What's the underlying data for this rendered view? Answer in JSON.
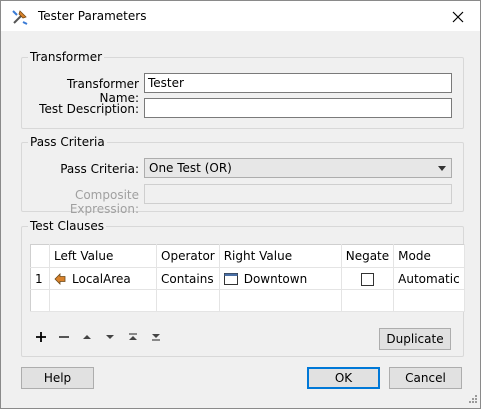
{
  "window": {
    "title": "Tester Parameters"
  },
  "transformer_group": {
    "label": "Transformer",
    "name_label": "Transformer Name:",
    "name_value": "Tester",
    "description_label": "Test Description:",
    "description_value": ""
  },
  "pass_criteria_group": {
    "label": "Pass Criteria",
    "criteria_label": "Pass Criteria:",
    "criteria_value": "One Test (OR)",
    "composite_label": "Composite Expression:",
    "composite_value": ""
  },
  "test_clauses_group": {
    "label": "Test Clauses",
    "columns": [
      "Left Value",
      "Operator",
      "Right Value",
      "Negate",
      "Mode"
    ],
    "rows": [
      {
        "num": "1",
        "left": "LocalArea",
        "operator": "Contains",
        "right": "Downtown",
        "negate": false,
        "mode": "Automatic"
      }
    ]
  },
  "toolbar": {
    "icons": [
      "add-icon",
      "remove-icon",
      "move-up-icon",
      "move-down-icon",
      "move-top-icon",
      "move-bottom-icon"
    ],
    "duplicate_label": "Duplicate"
  },
  "footer": {
    "help_label": "Help",
    "ok_label": "OK",
    "cancel_label": "Cancel"
  }
}
